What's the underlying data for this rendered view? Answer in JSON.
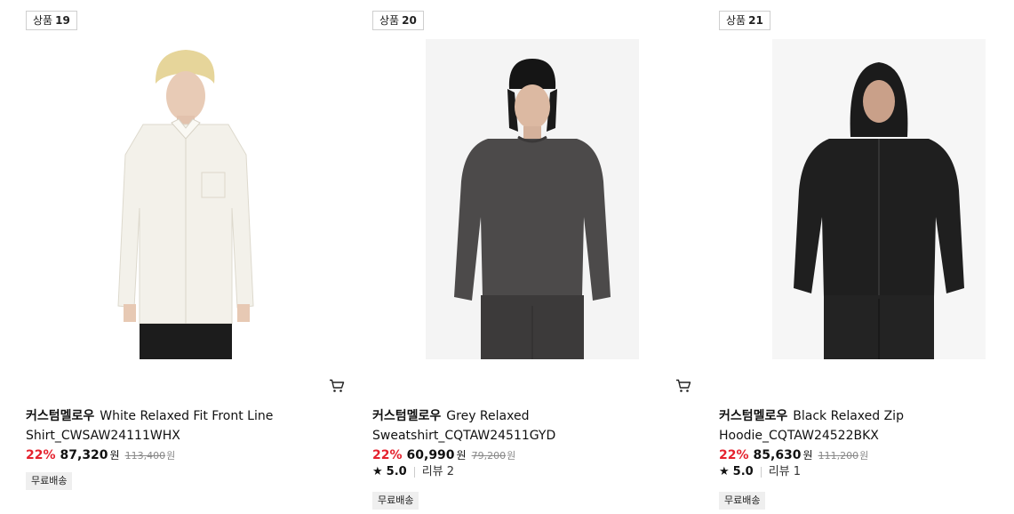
{
  "products": [
    {
      "badge_label": "상품",
      "badge_number": "19",
      "brand": "커스텀멜로우",
      "title": "White Relaxed Fit Front Line Shirt_CWSAW24111WHX",
      "discount": "22%",
      "price": "87,320",
      "currency": "원",
      "original_price": "113,400",
      "original_currency": "원",
      "rating": null,
      "reviews": null,
      "shipping_tag": "무료배송"
    },
    {
      "badge_label": "상품",
      "badge_number": "20",
      "brand": "커스텀멜로우",
      "title": "Grey Relaxed Sweatshirt_CQTAW24511GYD",
      "discount": "22%",
      "price": "60,990",
      "currency": "원",
      "original_price": "79,200",
      "original_currency": "원",
      "rating": "5.0",
      "reviews": "리뷰 2",
      "shipping_tag": "무료배송"
    },
    {
      "badge_label": "상품",
      "badge_number": "21",
      "brand": "커스텀멜로우",
      "title": "Black Relaxed Zip Hoodie_CQTAW24522BKX",
      "discount": "22%",
      "price": "85,630",
      "currency": "원",
      "original_price": "111,200",
      "original_currency": "원",
      "rating": "5.0",
      "reviews": "리뷰 1",
      "shipping_tag": "무료배송"
    }
  ],
  "icons": {
    "cart": "cart-icon",
    "star": "star-icon"
  },
  "colors": {
    "discount": "#e5222e",
    "tag_bg": "#efefef"
  }
}
